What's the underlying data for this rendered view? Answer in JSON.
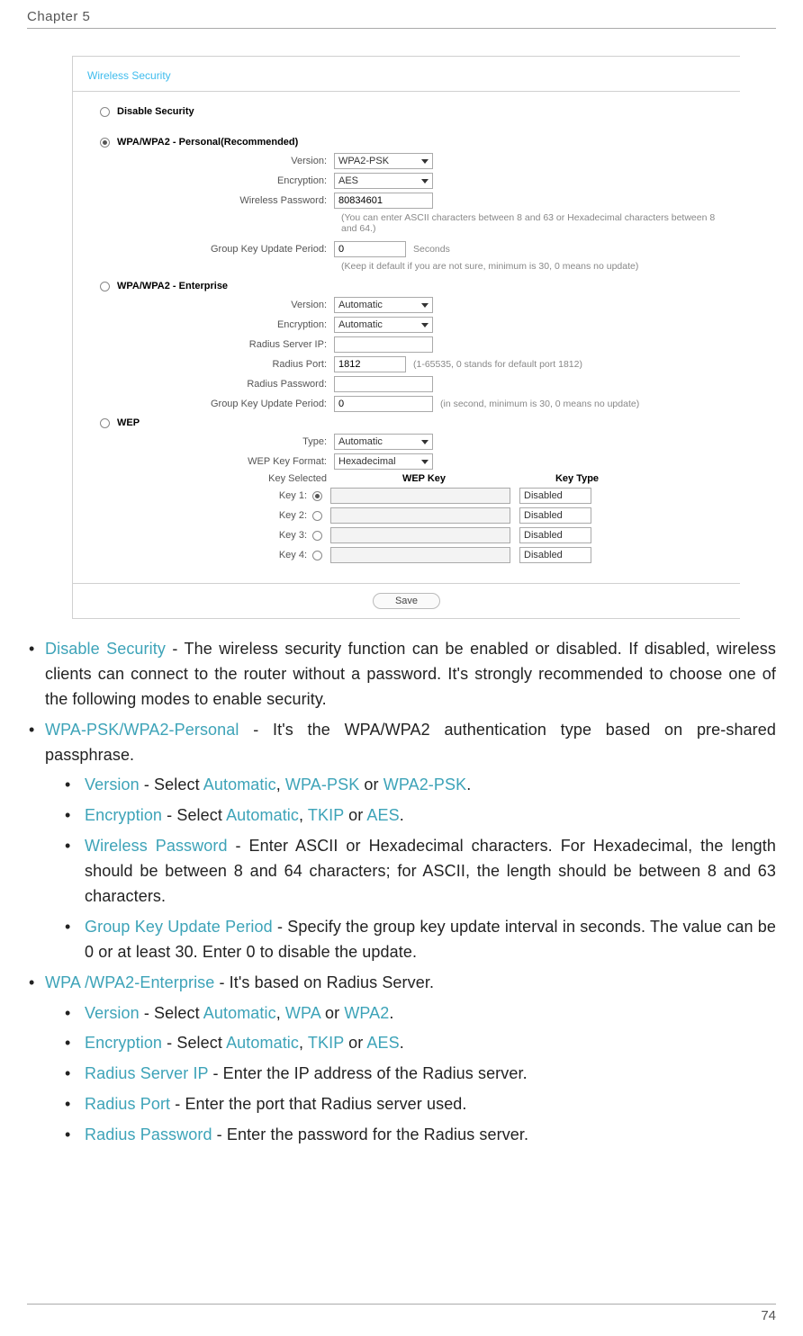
{
  "header": {
    "chapter": "Chapter 5",
    "page_number": "74"
  },
  "ui": {
    "title": "Wireless Security",
    "disable_label": "Disable Security",
    "personal": {
      "label": "WPA/WPA2 - Personal(Recommended)",
      "version_label": "Version:",
      "version_value": "WPA2-PSK",
      "encryption_label": "Encryption:",
      "encryption_value": "AES",
      "password_label": "Wireless Password:",
      "password_value": "80834601",
      "password_hint": "(You can enter ASCII characters between 8 and 63 or Hexadecimal characters between 8 and 64.)",
      "group_key_label": "Group Key Update Period:",
      "group_key_value": "0",
      "group_key_unit": "Seconds",
      "group_key_hint": "(Keep it default if you are not sure, minimum is 30, 0 means no update)"
    },
    "enterprise": {
      "label": "WPA/WPA2 - Enterprise",
      "version_label": "Version:",
      "version_value": "Automatic",
      "encryption_label": "Encryption:",
      "encryption_value": "Automatic",
      "radius_ip_label": "Radius Server IP:",
      "radius_ip_value": "",
      "radius_port_label": "Radius Port:",
      "radius_port_value": "1812",
      "radius_port_hint": "(1-65535, 0 stands for default port 1812)",
      "radius_pw_label": "Radius Password:",
      "radius_pw_value": "",
      "group_key_label": "Group Key Update Period:",
      "group_key_value": "0",
      "group_key_hint": "(in second, minimum is 30, 0 means no update)"
    },
    "wep": {
      "label": "WEP",
      "type_label": "Type:",
      "type_value": "Automatic",
      "format_label": "WEP Key Format:",
      "format_value": "Hexadecimal",
      "col_selected": "Key Selected",
      "col_key": "WEP Key",
      "col_type": "Key Type",
      "keys": [
        {
          "label": "Key 1:",
          "type": "Disabled"
        },
        {
          "label": "Key 2:",
          "type": "Disabled"
        },
        {
          "label": "Key 3:",
          "type": "Disabled"
        },
        {
          "label": "Key 4:",
          "type": "Disabled"
        }
      ]
    },
    "save_label": "Save"
  },
  "doc": {
    "b1": {
      "t": "Disable Security",
      "r": " - The wireless security function can be enabled or disabled. If disabled, wireless clients can connect to the router without a password. It's strongly recommended to choose one of the following modes to enable security."
    },
    "b2": {
      "t": "WPA-PSK/WPA2-Personal",
      "r": " - It's the WPA/WPA2 authentication type based on pre-shared passphrase.",
      "s1a": "Version",
      "s1b": " - Select ",
      "s1c": "Automatic",
      "s1d": ", ",
      "s1e": "WPA-PSK",
      "s1f": " or ",
      "s1g": "WPA2-PSK",
      "s1h": ".",
      "s2a": "Encryption",
      "s2b": " - Select ",
      "s2c": "Automatic",
      "s2d": ", ",
      "s2e": "TKIP",
      "s2f": " or ",
      "s2g": "AES",
      "s2h": ".",
      "s3a": "Wireless Password",
      "s3b": " - Enter ASCII or Hexadecimal characters. For Hexadecimal, the length should be between 8 and 64 characters; for ASCII, the length should be between 8 and 63 characters.",
      "s4a": "Group Key Update Period",
      "s4b": " - Specify the group key update interval in seconds. The value can be 0 or at least 30. Enter 0 to disable the update."
    },
    "b3": {
      "t": "WPA /WPA2-Enterprise",
      "r": " - It's based on Radius Server.",
      "s1a": "Version",
      "s1b": " - Select ",
      "s1c": "Automatic",
      "s1d": ", ",
      "s1e": "WPA",
      "s1f": " or ",
      "s1g": "WPA2",
      "s1h": ".",
      "s2a": "Encryption",
      "s2b": " - Select ",
      "s2c": "Automatic",
      "s2d": ", ",
      "s2e": "TKIP",
      "s2f": " or ",
      "s2g": "AES",
      "s2h": ".",
      "s3a": "Radius Server IP",
      "s3b": " - Enter the IP address of the Radius server.",
      "s4a": "Radius Port",
      "s4b": " - Enter the port that Radius server used.",
      "s5a": "Radius Password",
      "s5b": " - Enter the password for the Radius server."
    }
  }
}
